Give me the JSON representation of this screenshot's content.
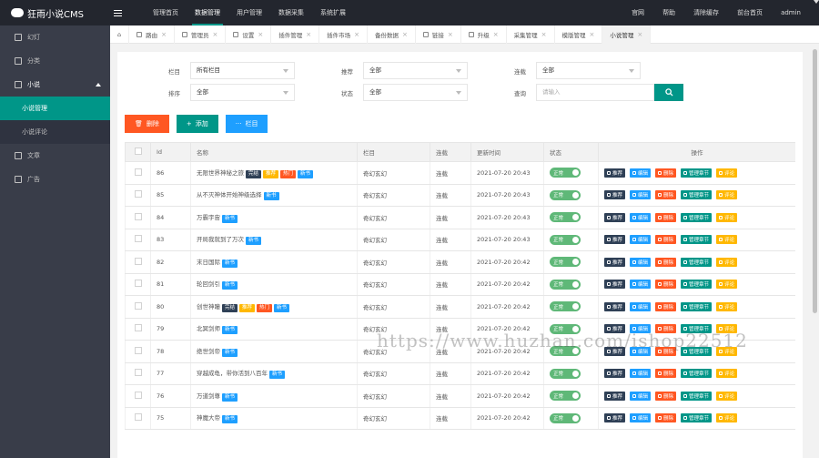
{
  "app": {
    "title": "狂雨小说CMS"
  },
  "topnav": [
    "管理首页",
    "数据管理",
    "用户管理",
    "数据采集",
    "系统扩展"
  ],
  "rightnav": [
    "官网",
    "帮助",
    "清除缓存",
    "前台首页",
    "admin"
  ],
  "sidebar": {
    "items": [
      {
        "label": "幻灯",
        "icon": "slides-icon"
      },
      {
        "label": "分类",
        "icon": "ellipsis-icon"
      },
      {
        "label": "小说",
        "icon": "book-icon"
      }
    ],
    "sub": [
      "小说管理",
      "小说评论"
    ],
    "after": [
      {
        "label": "文章",
        "icon": "article-icon"
      },
      {
        "label": "广告",
        "icon": "ad-icon"
      }
    ]
  },
  "tabs": [
    "路由",
    "管理员",
    "设置",
    "插件管理",
    "插件市场",
    "备份数据",
    "链接",
    "升级",
    "采集管理",
    "模版管理",
    "小说管理"
  ],
  "filters": {
    "col_label": "栏目",
    "col_value": "所有栏目",
    "rec_label": "推荐",
    "rec_value": "全部",
    "status_label": "连载",
    "status_value": "全部",
    "sort_label": "排序",
    "sort_value": "全部",
    "state_label": "状态",
    "state_value": "全部",
    "search_label": "查询",
    "search_placeholder": "请输入"
  },
  "buttons": {
    "delete": "删除",
    "add": "添加",
    "column": "栏目"
  },
  "table": {
    "headers": [
      "Id",
      "名称",
      "栏目",
      "连载",
      "更新时间",
      "状态",
      "操作"
    ],
    "status_label": "正常",
    "ops": [
      "推荐",
      "编辑",
      "删除",
      "管理章节",
      "评论"
    ],
    "rows": [
      {
        "id": "86",
        "name": "无限世界神秘之旅",
        "tags": [
          "完结",
          "推荐",
          "热门",
          "新书"
        ],
        "col": "奇幻玄幻",
        "serial": "连载",
        "time": "2021-07-20 20:43"
      },
      {
        "id": "85",
        "name": "从不灭神体开始神级选择",
        "tags": [
          "新书"
        ],
        "col": "奇幻玄幻",
        "serial": "连载",
        "time": "2021-07-20 20:43"
      },
      {
        "id": "84",
        "name": "万霸宇宙",
        "tags": [
          "新书"
        ],
        "col": "奇幻玄幻",
        "serial": "连载",
        "time": "2021-07-20 20:43"
      },
      {
        "id": "83",
        "name": "开局我就到了万次",
        "tags": [
          "新书"
        ],
        "col": "奇幻玄幻",
        "serial": "连载",
        "time": "2021-07-20 20:43"
      },
      {
        "id": "82",
        "name": "末日国际",
        "tags": [
          "新书"
        ],
        "col": "奇幻玄幻",
        "serial": "连载",
        "time": "2021-07-20 20:42"
      },
      {
        "id": "81",
        "name": "轮回剑引",
        "tags": [
          "新书"
        ],
        "col": "奇幻玄幻",
        "serial": "连载",
        "time": "2021-07-20 20:42"
      },
      {
        "id": "80",
        "name": "创世神瞳",
        "tags": [
          "完结",
          "推荐",
          "热门",
          "新书"
        ],
        "col": "奇幻玄幻",
        "serial": "连载",
        "time": "2021-07-20 20:42"
      },
      {
        "id": "79",
        "name": "北冥剑师",
        "tags": [
          "新书"
        ],
        "col": "奇幻玄幻",
        "serial": "连载",
        "time": "2021-07-20 20:42"
      },
      {
        "id": "78",
        "name": "绝世剑帝",
        "tags": [
          "新书"
        ],
        "col": "奇幻玄幻",
        "serial": "连载",
        "time": "2021-07-20 20:42"
      },
      {
        "id": "77",
        "name": "穿越成龟，带你活到八百年",
        "tags": [
          "新书"
        ],
        "col": "奇幻玄幻",
        "serial": "连载",
        "time": "2021-07-20 20:42"
      },
      {
        "id": "76",
        "name": "万道剑尊",
        "tags": [
          "新书"
        ],
        "col": "奇幻玄幻",
        "serial": "连载",
        "time": "2021-07-20 20:42"
      },
      {
        "id": "75",
        "name": "神魔大帝",
        "tags": [
          "新书"
        ],
        "col": "奇幻玄幻",
        "serial": "连载",
        "time": "2021-07-20 20:42"
      }
    ]
  },
  "watermark": "https://www.huzhan.com/ishop22512",
  "colors": {
    "accent": "#009688",
    "topbar": "#23262e",
    "sidebar": "#393d49",
    "danger": "#ff5722",
    "info": "#1e9fff",
    "warn": "#ffb800"
  }
}
